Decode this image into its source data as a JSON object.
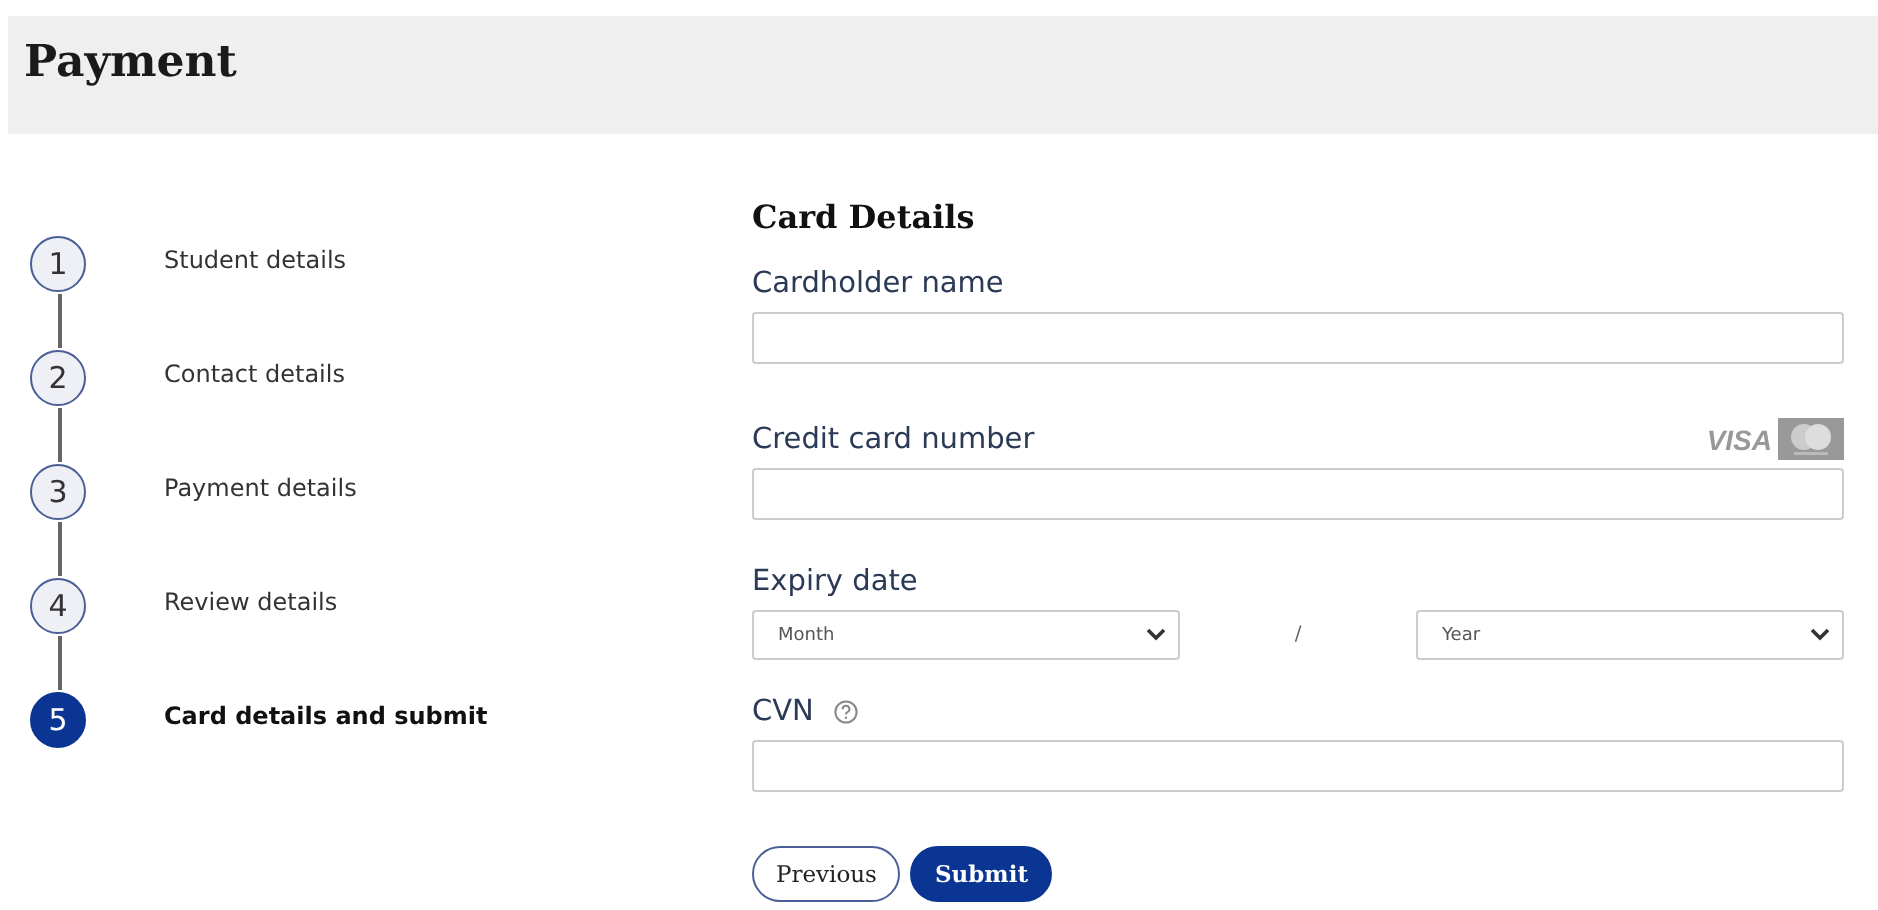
{
  "header": {
    "title": "Payment"
  },
  "steps": [
    {
      "number": "1",
      "label": "Student details",
      "current": false
    },
    {
      "number": "2",
      "label": "Contact details",
      "current": false
    },
    {
      "number": "3",
      "label": "Payment details",
      "current": false
    },
    {
      "number": "4",
      "label": "Review details",
      "current": false
    },
    {
      "number": "5",
      "label": "Card details and submit",
      "current": true
    }
  ],
  "form": {
    "heading": "Card Details",
    "cardholder_name": {
      "label": "Cardholder name"
    },
    "card_number": {
      "label": "Credit card number",
      "visa_logo": "VISA"
    },
    "expiry": {
      "label": "Expiry date",
      "month": {
        "value": "Month"
      },
      "separator": "/",
      "year": {
        "value": "Year"
      }
    },
    "cvn": {
      "label": "CVN"
    },
    "buttons": [
      {
        "kind": "secondary",
        "label": "Previous"
      },
      {
        "kind": "primary",
        "label": "Submit"
      }
    ]
  }
}
